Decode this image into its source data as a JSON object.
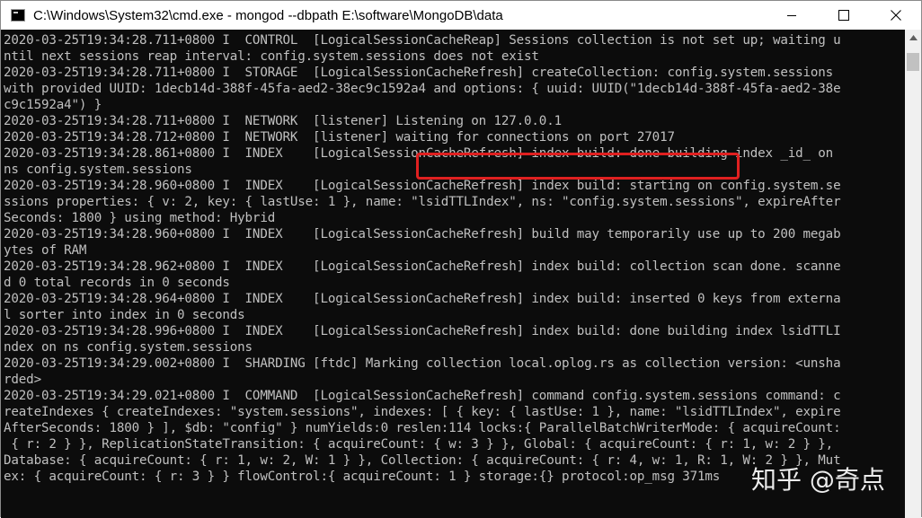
{
  "window": {
    "title": "C:\\Windows\\System32\\cmd.exe - mongod  --dbpath E:\\software\\MongoDB\\data",
    "icon": "cmd-icon"
  },
  "console": {
    "lines": [
      "2020-03-25T19:34:28.711+0800 I  CONTROL  [LogicalSessionCacheReap] Sessions collection is not set up; waiting u",
      "ntil next sessions reap interval: config.system.sessions does not exist",
      "2020-03-25T19:34:28.711+0800 I  STORAGE  [LogicalSessionCacheRefresh] createCollection: config.system.sessions",
      "with provided UUID: 1decb14d-388f-45fa-aed2-38ec9c1592a4 and options: { uuid: UUID(\"1decb14d-388f-45fa-aed2-38e",
      "c9c1592a4\") }",
      "2020-03-25T19:34:28.711+0800 I  NETWORK  [listener] Listening on 127.0.0.1",
      "2020-03-25T19:34:28.712+0800 I  NETWORK  [listener] waiting for connections on port 27017",
      "2020-03-25T19:34:28.861+0800 I  INDEX    [LogicalSessionCacheRefresh] index build: done building index _id_ on",
      "ns config.system.sessions",
      "2020-03-25T19:34:28.960+0800 I  INDEX    [LogicalSessionCacheRefresh] index build: starting on config.system.se",
      "ssions properties: { v: 2, key: { lastUse: 1 }, name: \"lsidTTLIndex\", ns: \"config.system.sessions\", expireAfter",
      "Seconds: 1800 } using method: Hybrid",
      "2020-03-25T19:34:28.960+0800 I  INDEX    [LogicalSessionCacheRefresh] build may temporarily use up to 200 megab",
      "ytes of RAM",
      "2020-03-25T19:34:28.962+0800 I  INDEX    [LogicalSessionCacheRefresh] index build: collection scan done. scanne",
      "d 0 total records in 0 seconds",
      "2020-03-25T19:34:28.964+0800 I  INDEX    [LogicalSessionCacheRefresh] index build: inserted 0 keys from externa",
      "l sorter into index in 0 seconds",
      "2020-03-25T19:34:28.996+0800 I  INDEX    [LogicalSessionCacheRefresh] index build: done building index lsidTTLI",
      "ndex on ns config.system.sessions",
      "2020-03-25T19:34:29.002+0800 I  SHARDING [ftdc] Marking collection local.oplog.rs as collection version: <unsha",
      "rded>",
      "2020-03-25T19:34:29.021+0800 I  COMMAND  [LogicalSessionCacheRefresh] command config.system.sessions command: c",
      "reateIndexes { createIndexes: \"system.sessions\", indexes: [ { key: { lastUse: 1 }, name: \"lsidTTLIndex\", expire",
      "AfterSeconds: 1800 } ], $db: \"config\" } numYields:0 reslen:114 locks:{ ParallelBatchWriterMode: { acquireCount:",
      " { r: 2 } }, ReplicationStateTransition: { acquireCount: { w: 3 } }, Global: { acquireCount: { r: 1, w: 2 } },",
      "Database: { acquireCount: { r: 1, w: 2, W: 1 } }, Collection: { acquireCount: { r: 4, w: 1, R: 1, W: 2 } }, Mut",
      "ex: { acquireCount: { r: 3 } } flowControl:{ acquireCount: 1 } storage:{} protocol:op_msg 371ms"
    ]
  },
  "watermark": {
    "text": "知乎 @奇点"
  },
  "colors": {
    "console_bg": "#0c0c0c",
    "console_text": "#c0c0c0",
    "highlight": "#e02020"
  }
}
